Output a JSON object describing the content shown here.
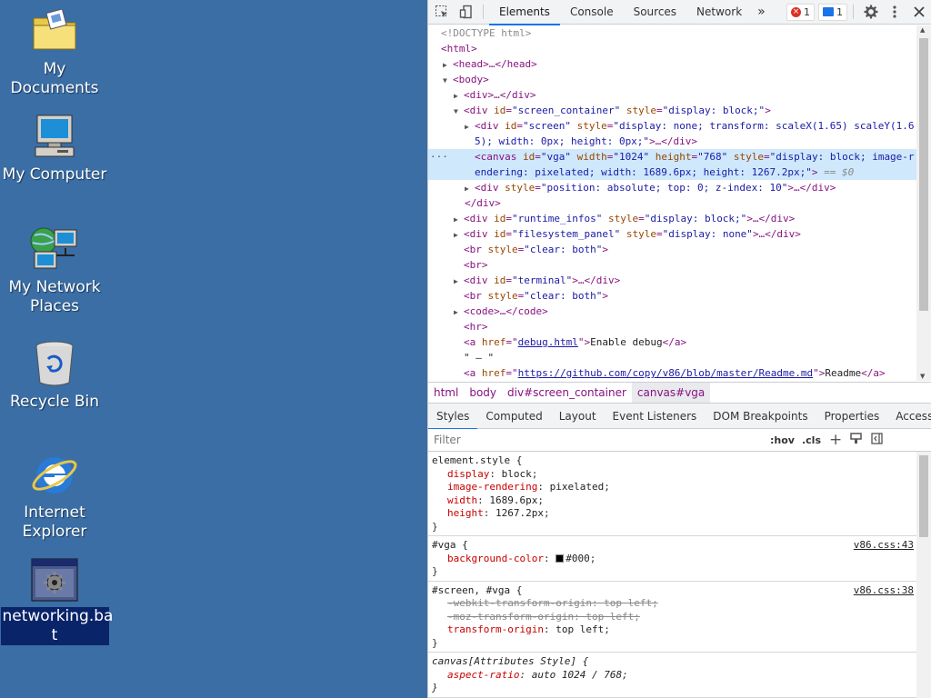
{
  "desktop": {
    "background": "#3a6ea5",
    "icons": [
      {
        "label": "My Documents",
        "icon": "folder-documents-icon"
      },
      {
        "label": "My Computer",
        "icon": "computer-icon"
      },
      {
        "label": "My Network\nPlaces",
        "icon": "network-places-icon"
      },
      {
        "label": "Recycle Bin",
        "icon": "recycle-bin-icon"
      },
      {
        "label": "Internet\nExplorer",
        "icon": "internet-explorer-icon"
      },
      {
        "label": "networking.ba\nt",
        "icon": "batch-file-icon",
        "selected": true
      }
    ]
  },
  "devtools": {
    "tabs": [
      "Elements",
      "Console",
      "Sources",
      "Network"
    ],
    "active_tab": "Elements",
    "more": "»",
    "error_count": "1",
    "message_count": "1",
    "dom": {
      "l0": "<!DOCTYPE html>",
      "l1": "<html>",
      "l2": "<head>…</head>",
      "l3": "<body>",
      "l4": "<div>…</div>",
      "l5a": "<div ",
      "l5b": "id",
      "l5c": "\"screen_container\"",
      "l5d": "style",
      "l5e": "\"display: block;\"",
      "l6a": "<div ",
      "l6b": "id",
      "l6c": "\"screen\"",
      "l6d": "style",
      "l6e": "\"display: none; transform: scaleX(1.65) scaleY(1.6",
      "l7": "5); width: 0px; height: 0px;\"",
      "l8a": "<canvas ",
      "l8b": "id",
      "l8c": "\"vga\"",
      "l8d": "width",
      "l8e": "\"1024\"",
      "l8f": "height",
      "l8g": "\"768\"",
      "l8h": "style",
      "l8i": "\"display: block; image-r",
      "l9": "endering: pixelated; width: 1689.6px; height: 1267.2px;\"",
      "l9eq": " == $0",
      "l10a": "<div ",
      "l10b": "style",
      "l10c": "\"position: absolute; top: 0; z-index: 10\"",
      "l11": "</div>",
      "l12a": "<div ",
      "l12b": "id",
      "l12c": "\"runtime_infos\"",
      "l12d": "style",
      "l12e": "\"display: block;\"",
      "l13a": "<div ",
      "l13b": "id",
      "l13c": "\"filesystem_panel\"",
      "l13d": "style",
      "l13e": "\"display: none\"",
      "l14a": "<br ",
      "l14b": "style",
      "l14c": "\"clear: both\"",
      "l15": "<br>",
      "l16a": "<div ",
      "l16b": "id",
      "l16c": "\"terminal\"",
      "l17a": "<br ",
      "l17b": "style",
      "l17c": "\"clear: both\"",
      "l18": "<code>…</code>",
      "l19": "<hr>",
      "l20a": "<a ",
      "l20b": "href",
      "l20c": "debug.html",
      "l20d": "Enable debug",
      "l21": "\" — \"",
      "l22a": "<a ",
      "l22b": "href",
      "l22c": "https://github.com/copy/v86/blob/master/Readme.md",
      "l22d": "Readme"
    },
    "breadcrumbs": [
      "html",
      "body",
      "div#screen_container",
      "canvas#vga"
    ],
    "style_tabs": [
      "Styles",
      "Computed",
      "Layout",
      "Event Listeners",
      "DOM Breakpoints",
      "Properties",
      "Accessibility"
    ],
    "filter_placeholder": "Filter",
    "hov": ":hov",
    "cls": ".cls",
    "rules": {
      "r1_selector": "element.style {",
      "r1": [
        [
          "display",
          "block"
        ],
        [
          "image-rendering",
          "pixelated"
        ],
        [
          "width",
          "1689.6px"
        ],
        [
          "height",
          "1267.2px"
        ]
      ],
      "r2_selector": "#vga {",
      "r2_source": "v86.css:43",
      "r2_prop": "background-color",
      "r2_val": "#000",
      "r3_selector": "#screen, #vga {",
      "r3_source": "v86.css:38",
      "r3_s1": "-webkit-transform-origin: top left;",
      "r3_s2": "-moz-transform-origin: top left;",
      "r3_prop": "transform-origin",
      "r3_val": "top left",
      "r4_selector": "canvas[Attributes Style] {",
      "r4_prop": "aspect-ratio",
      "r4_val": "auto 1024 / 768",
      "close": "}"
    }
  }
}
